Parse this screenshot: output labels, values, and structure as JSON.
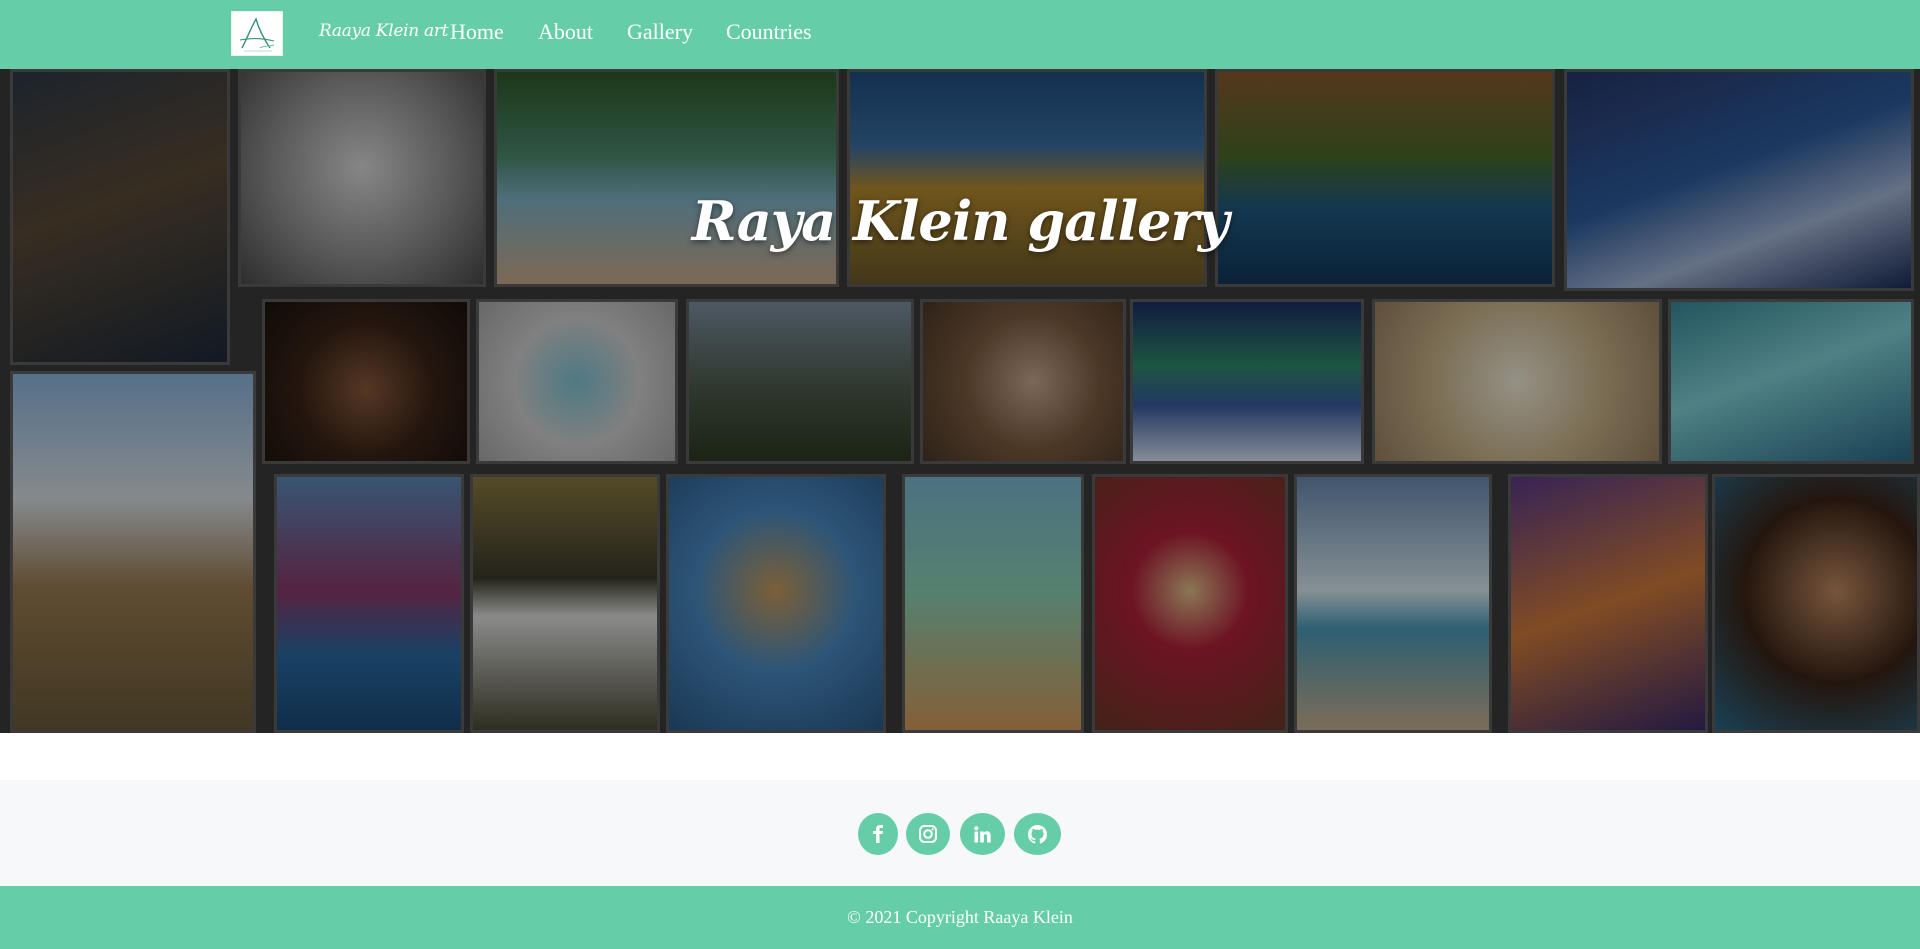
{
  "brand": {
    "logo_icon": "artist-signature-logo",
    "name": "Raaya Klein art"
  },
  "nav": {
    "items": [
      {
        "label": "Home"
      },
      {
        "label": "About"
      },
      {
        "label": "Gallery"
      },
      {
        "label": "Countries"
      }
    ]
  },
  "hero": {
    "title": "Raya Klein gallery",
    "background": "collage of paintings",
    "overlay_opacity": 0.38
  },
  "social": {
    "buttons": [
      {
        "icon": "facebook-icon"
      },
      {
        "icon": "instagram-icon"
      },
      {
        "icon": "linkedin-icon"
      },
      {
        "icon": "github-icon"
      }
    ]
  },
  "footer": {
    "copyright": "© 2021 Copyright Raaya Klein"
  },
  "colors": {
    "accent": "#66cda9",
    "social_bar_bg": "#f7f8f9",
    "text_on_accent": "#ffffff"
  }
}
